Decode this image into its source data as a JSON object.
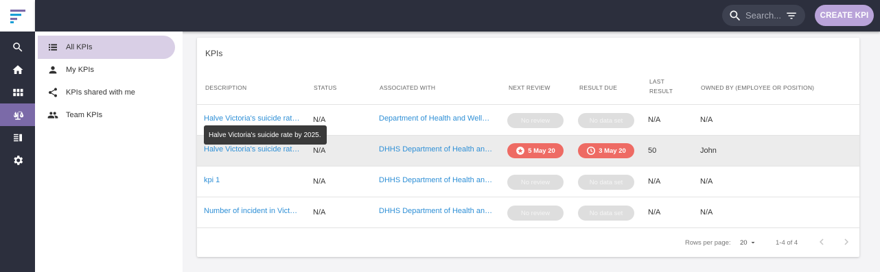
{
  "topbar": {
    "search_placeholder": "Search...",
    "create_button": "CREATE KPI"
  },
  "sidebar": {
    "items": [
      {
        "label": "All KPIs",
        "icon": "list-icon",
        "active": true
      },
      {
        "label": "My KPIs",
        "icon": "person-icon",
        "active": false
      },
      {
        "label": "KPIs shared with me",
        "icon": "share-icon",
        "active": false
      },
      {
        "label": "Team KPIs",
        "icon": "people-icon",
        "active": false
      }
    ]
  },
  "rail": {
    "items": [
      "search-icon",
      "home-icon",
      "apps-grid-icon",
      "scale-icon",
      "book-icon",
      "gear-icon"
    ],
    "active": "scale-icon"
  },
  "card": {
    "title": "KPIs",
    "columns": {
      "description": "DESCRIPTION",
      "status": "STATUS",
      "associated": "ASSOCIATED WITH",
      "next_review": "NEXT REVIEW",
      "result_due": "RESULT DUE",
      "last_result_1": "LAST",
      "last_result_2": "RESULT",
      "owned_by": "OWNED BY (EMPLOYEE OR POSITION)"
    },
    "rows": [
      {
        "description": "Halve Victoria's suicide rate by 2025.",
        "status": "N/A",
        "associated": "Department of Health and Wellbeing",
        "next_review": "No review",
        "result_due": "No data set",
        "last_result": "N/A",
        "owned_by": "N/A"
      },
      {
        "description": "Halve Victoria's suicide rate by 2025.",
        "status": "N/A",
        "associated": "DHHS Department of Health and Human Services",
        "next_review": "5 May 20",
        "result_due": "3 May 20",
        "last_result": "50",
        "owned_by": "John"
      },
      {
        "description": "kpi 1",
        "status": "N/A",
        "associated": "DHHS Department of Health and Human Services",
        "next_review": "No review",
        "result_due": "No data set",
        "last_result": "N/A",
        "owned_by": "N/A"
      },
      {
        "description": "Number of incident in Victoria",
        "status": "N/A",
        "associated": "DHHS Department of Health and Human Services",
        "next_review": "No review",
        "result_due": "No data set",
        "last_result": "N/A",
        "owned_by": "N/A"
      }
    ],
    "footer": {
      "rows_per_page_label": "Rows per page:",
      "rows_per_page_value": "20",
      "range": "1-4 of 4"
    }
  },
  "tooltip": "Halve Victoria's suicide rate by 2025.",
  "colors": {
    "rail_bg": "#2c2f3d",
    "accent": "#b9a3d9",
    "link": "#2e8fd6",
    "overdue": "#ee6b64"
  }
}
